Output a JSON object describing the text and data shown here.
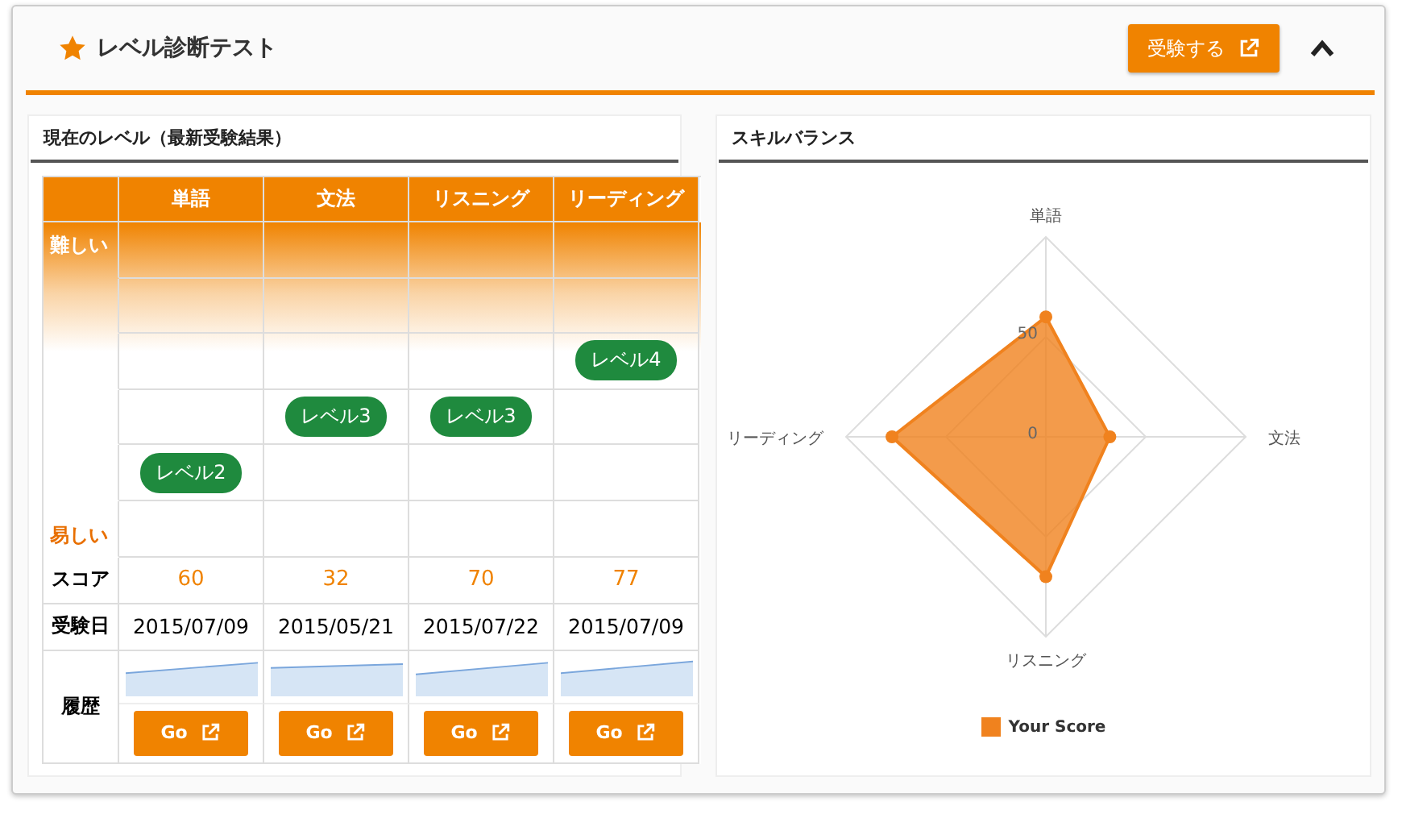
{
  "header": {
    "title": "レベル診断テスト",
    "take_button": "受験する",
    "collapsed": false
  },
  "current_level": {
    "title": "現在のレベル（最新受験結果）",
    "hard_label": "難しい",
    "easy_label": "易しい",
    "score_label": "スコア",
    "date_label": "受験日",
    "history_label": "履歴",
    "skills": [
      {
        "name": "単語",
        "badge": "レベル2",
        "levels": [
          {
            "selected": false
          },
          {
            "selected": false
          },
          {
            "selected": false
          },
          {
            "selected": false
          },
          {
            "selected": true
          },
          {
            "selected": false
          }
        ],
        "score": "60",
        "date": "2015/07/09",
        "go": "Go"
      },
      {
        "name": "文法",
        "badge": "レベル3",
        "levels": [
          {
            "selected": false
          },
          {
            "selected": false
          },
          {
            "selected": false
          },
          {
            "selected": true
          },
          {
            "selected": false
          },
          {
            "selected": false
          }
        ],
        "score": "32",
        "date": "2015/05/21",
        "go": "Go"
      },
      {
        "name": "リスニング",
        "badge": "レベル3",
        "levels": [
          {
            "selected": false
          },
          {
            "selected": false
          },
          {
            "selected": false
          },
          {
            "selected": true
          },
          {
            "selected": false
          },
          {
            "selected": false
          }
        ],
        "score": "70",
        "date": "2015/07/22",
        "go": "Go"
      },
      {
        "name": "リーディング",
        "badge": "レベル4",
        "levels": [
          {
            "selected": false
          },
          {
            "selected": false
          },
          {
            "selected": true
          },
          {
            "selected": false
          },
          {
            "selected": false
          },
          {
            "selected": false
          }
        ],
        "score": "77",
        "date": "2015/07/09",
        "go": "Go"
      }
    ]
  },
  "skill_balance": {
    "title": "スキルバランス",
    "chart_data": {
      "type": "radar",
      "categories": [
        "単語",
        "文法",
        "リスニング",
        "リーディング"
      ],
      "ylim": [
        0,
        100
      ],
      "yticks": [
        0,
        50
      ],
      "series": [
        {
          "name": "Your Score",
          "color": "#f0821e",
          "values": [
            60,
            32,
            70,
            77
          ]
        }
      ]
    }
  }
}
